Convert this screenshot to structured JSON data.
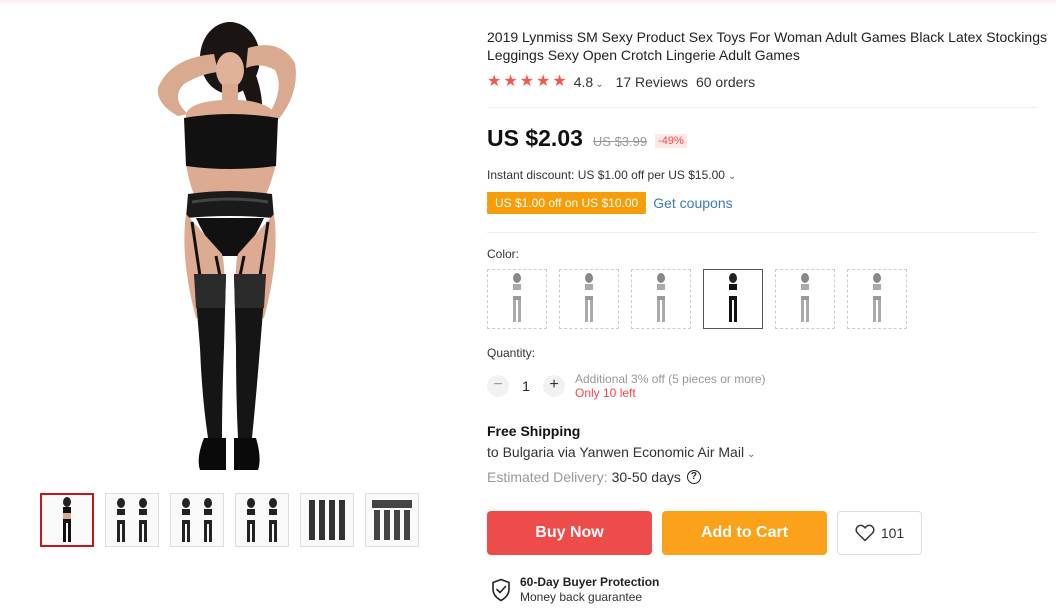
{
  "product": {
    "title": "2019 Lynmiss SM Sexy Product Sex Toys For Woman Adult Games Black Latex Stockings Leggings Sexy Open Crotch Lingerie Adult Games",
    "rating": "4.8",
    "rating_caret": "⌄",
    "stars": 5,
    "reviews": "17 Reviews",
    "orders": "60 orders"
  },
  "price": {
    "current": "US $2.03",
    "original": "US $3.99",
    "discount": "-49%"
  },
  "discount": {
    "instant": "Instant discount: US $1.00 off per US $15.00",
    "coupon": "US $1.00 off on US $10.00",
    "get_coupons": "Get coupons"
  },
  "color": {
    "label": "Color:",
    "selected_index": 3,
    "options_count": 6
  },
  "quantity": {
    "label": "Quantity:",
    "value": "1",
    "minus": "−",
    "plus": "+",
    "additional": "Additional 3% off (5 pieces or more)",
    "stock": "Only 10 left"
  },
  "shipping": {
    "title": "Free Shipping",
    "to": "to Bulgaria via Yanwen Economic Air Mail",
    "delivery_label": "Estimated Delivery:",
    "delivery_days": "30-50 days",
    "help_icon": "?"
  },
  "actions": {
    "buy_now": "Buy Now",
    "add_to_cart": "Add to Cart",
    "wishlist_count": "101"
  },
  "protection": {
    "title": "60-Day Buyer Protection",
    "subtitle": "Money back guarantee"
  },
  "gallery": {
    "thumbnails_count": 6,
    "active_index": 0
  },
  "colors": {
    "star": "#f3594e",
    "buy": "#ee4b4b",
    "cart": "#fba21a",
    "coupon": "#f59d0b",
    "link": "#3e7ab8"
  }
}
